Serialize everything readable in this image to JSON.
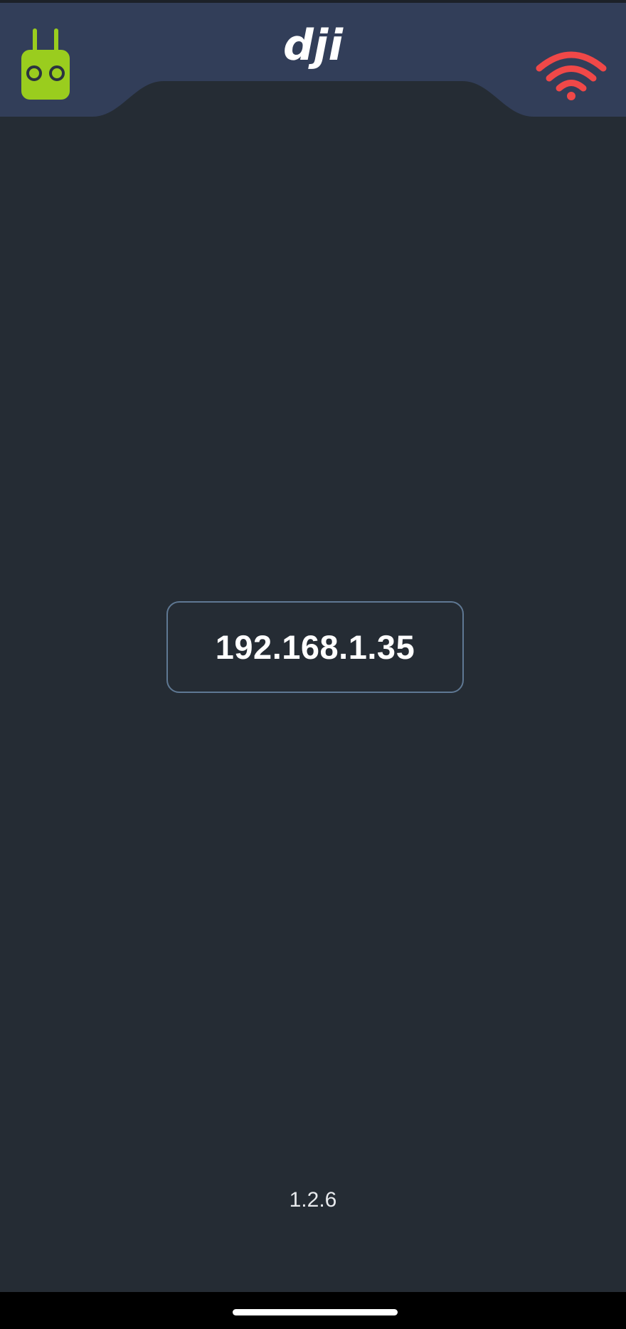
{
  "header": {
    "logo_text": "dji",
    "left_icon": "remote-controller-icon",
    "right_icon": "wifi-icon",
    "colors": {
      "header_bg": "#323e59",
      "controller_icon": "#9acd1e",
      "wifi_icon_status": "#f04848"
    }
  },
  "main": {
    "ip_address": "192.168.1.35"
  },
  "footer": {
    "version": "1.2.6"
  },
  "colors": {
    "background": "#252c34",
    "ip_box_border": "#5f7893",
    "text": "#ffffff"
  }
}
